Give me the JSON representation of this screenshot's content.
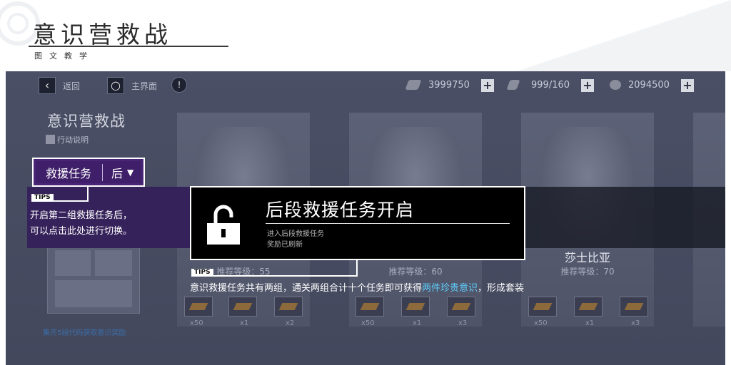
{
  "header": {
    "title": "意识营救战",
    "subtitle": "图文教学"
  },
  "topbar": {
    "back_label": "返回",
    "home_label": "主界面",
    "resources": [
      {
        "icon": "stamina-icon",
        "value": "3999750"
      },
      {
        "icon": "blackcard-icon",
        "value": "999/160"
      },
      {
        "icon": "coin-icon",
        "value": "2094500"
      }
    ]
  },
  "left_panel": {
    "title": "意识营救战",
    "action_info": "行动说明",
    "rescue_label": "救援任务",
    "rescue_phase": "后",
    "collect_hint": "集齐5段代码获取意识奖励"
  },
  "cards": [
    {
      "name": "",
      "level": "推荐等级：55",
      "rewards": [
        "x50",
        "x1",
        "x2"
      ]
    },
    {
      "name": "",
      "level": "推荐等级：60",
      "rewards": [
        "x50",
        "x1",
        "x3"
      ]
    },
    {
      "name": "莎士比亚",
      "level": "推荐等级：70",
      "rewards": [
        "x50",
        "x1",
        "x3"
      ]
    }
  ],
  "tips_label": "TIPS",
  "tip1": [
    "开启第二组救援任务后，",
    "可以点击此处进行切换。"
  ],
  "popup": {
    "title": "后段救援任务开启",
    "line1": "进入后段救援任务",
    "line2": "奖励已刷新"
  },
  "tip2": {
    "text_before": "意识救援任务共有两组，通关两组合计十个任务即可获得",
    "highlight": "两件珍贵意识",
    "text_after": "，形成套装"
  },
  "colors": {
    "accent_purple": "#3f1f69",
    "highlight_cyan": "#5fd1ff"
  }
}
